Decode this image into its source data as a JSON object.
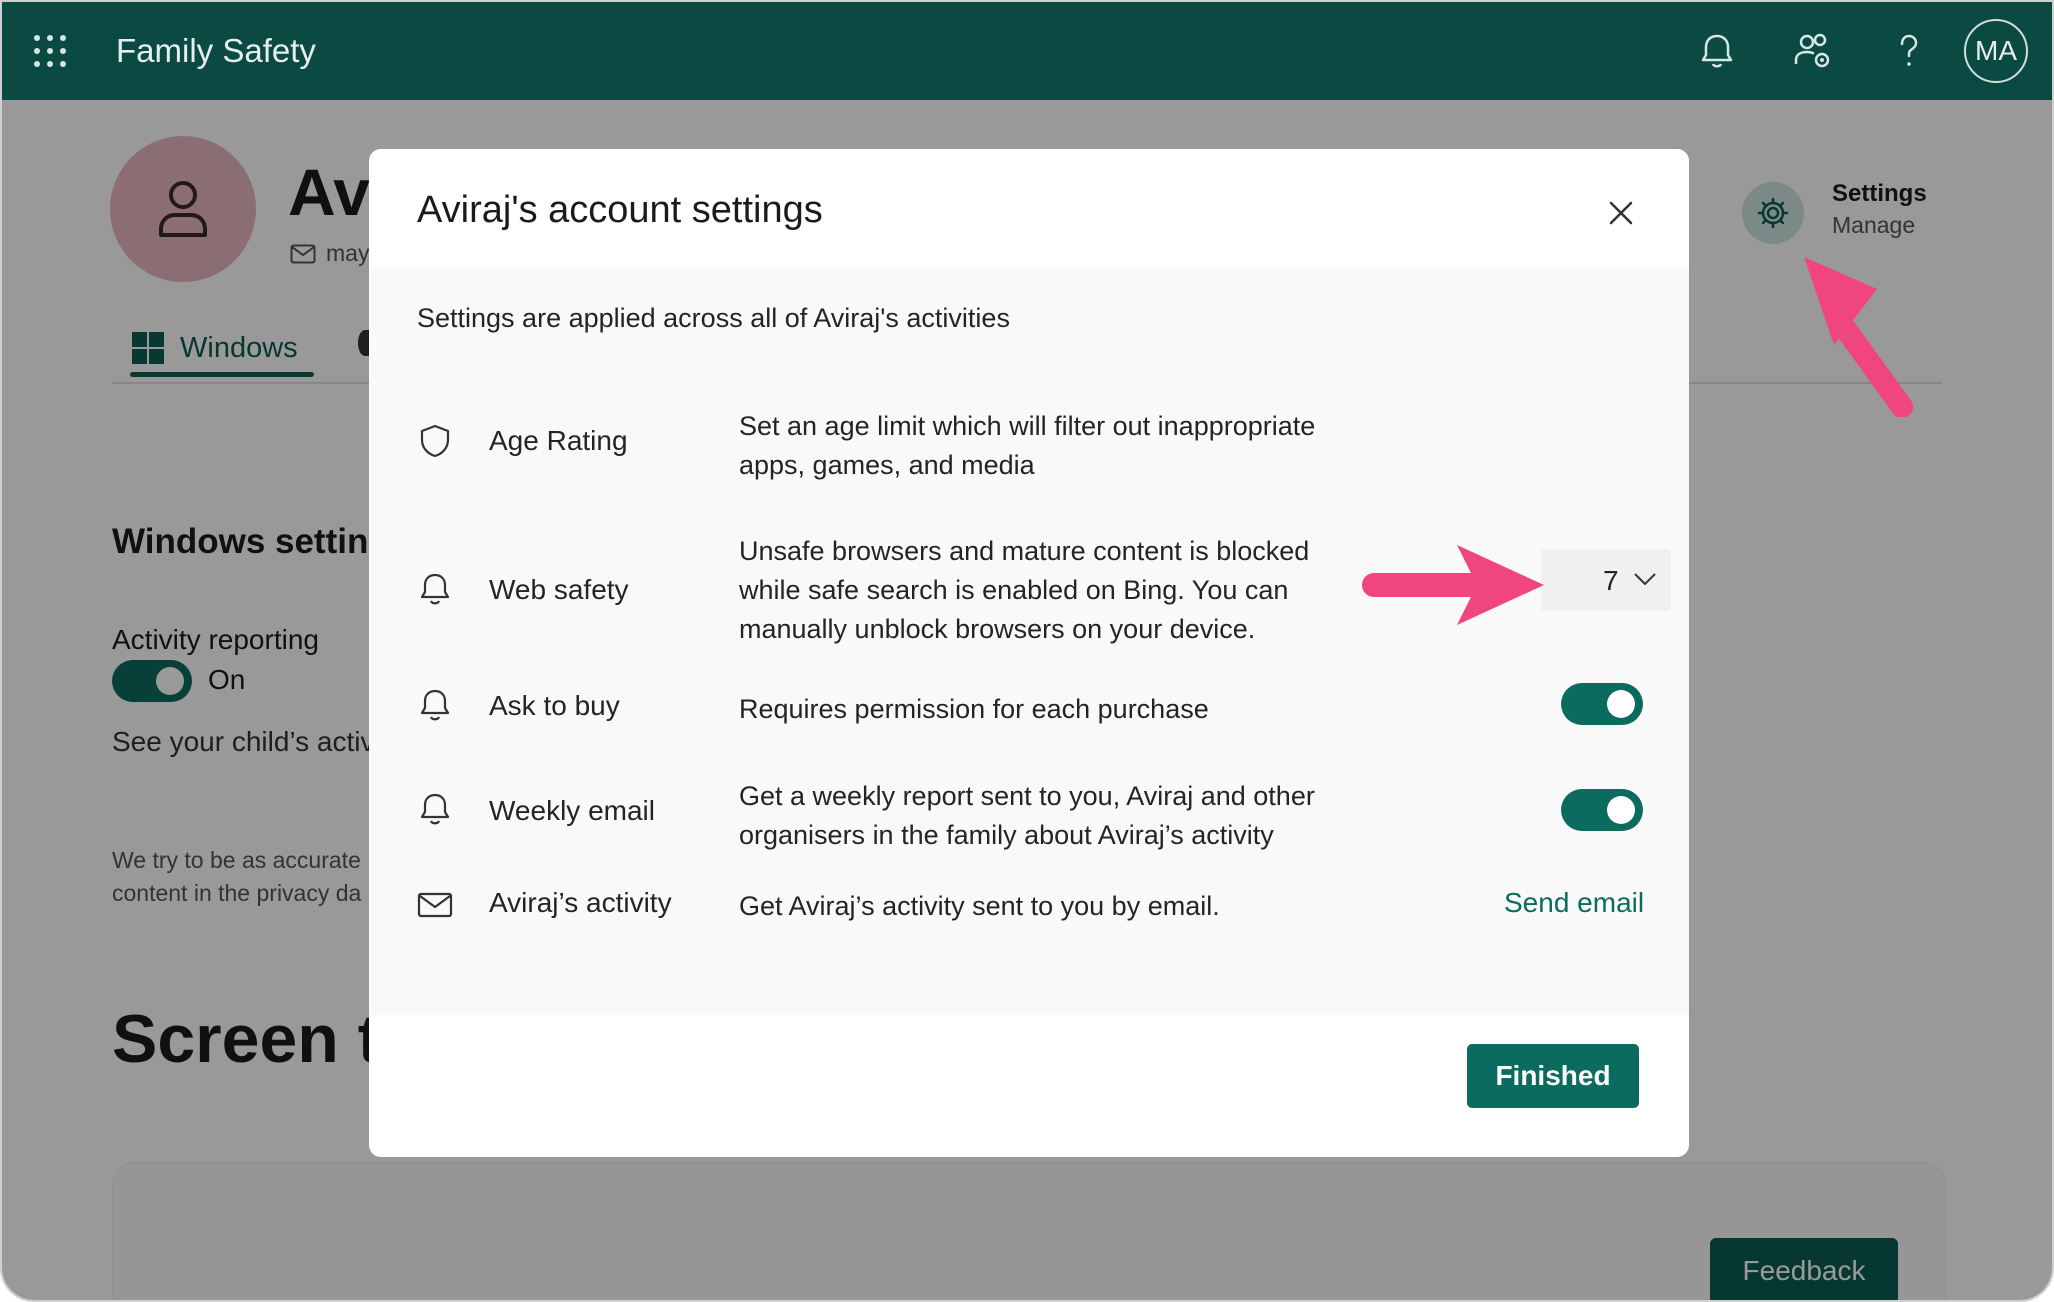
{
  "topbar": {
    "title": "Family Safety",
    "avatar_initials": "MA",
    "icons": [
      "waffle-icon",
      "bell-icon",
      "people-settings-icon",
      "help-icon"
    ]
  },
  "background": {
    "profile_name": "Avi",
    "profile_email": "may",
    "tab_windows": "Windows",
    "settings_label": "Settings",
    "settings_manage": "Manage",
    "section_title": "Windows settin",
    "activity_label": "Activity reporting",
    "activity_state": "On",
    "see_text": "See your child’s activ",
    "small_text_1": "We try to be as accurate",
    "small_text_2": "content in the privacy da",
    "screen_title": "Screen ti",
    "feedback": "Feedback"
  },
  "modal": {
    "title": "Aviraj's account settings",
    "intro": "Settings are applied across all of Aviraj's activities",
    "rows": [
      {
        "label": "Age Rating",
        "desc_line1": "Set an age limit which will filter out inappropriate",
        "desc_line2": "apps, games, and media",
        "control": "select",
        "value": "7"
      },
      {
        "label": "Web safety",
        "desc_line1": "Unsafe browsers and mature content is blocked",
        "desc_line2": "while safe search is enabled on Bing. You can",
        "desc_line3": "manually unblock browsers on your device.",
        "control": "toggle",
        "on": true
      },
      {
        "label": "Ask to buy",
        "desc_line1": "Requires permission for each purchase",
        "control": "toggle",
        "on": true
      },
      {
        "label": "Weekly email",
        "desc_line1": "Get a weekly report sent to you, Aviraj and other",
        "desc_line2": "organisers in the family about Aviraj’s activity",
        "control": "toggle",
        "on": true
      },
      {
        "label": "Aviraj’s activity",
        "desc_line1": "Get Aviraj’s activity sent to you by email.",
        "control": "link",
        "link_label": "Send email"
      }
    ],
    "finished_label": "Finished"
  },
  "colors": {
    "topbar": "#0b4a42",
    "accent": "#0b6b5e",
    "annotation_arrow": "#f0457f"
  }
}
